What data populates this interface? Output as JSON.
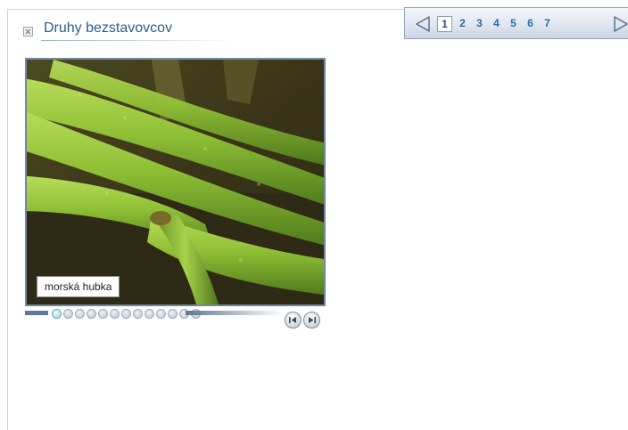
{
  "header": {
    "title": "Druhy bezstavovcov",
    "close_icon": "x-icon"
  },
  "pager": {
    "prev_icon": "triangle-left-icon",
    "next_icon": "triangle-right-icon",
    "pages": [
      "1",
      "2",
      "3",
      "4",
      "5",
      "6",
      "7"
    ],
    "current_page": "1"
  },
  "gallery": {
    "caption": "morská hubka",
    "slide_count": 13,
    "current_slide": 1,
    "prev_icon": "rewind-icon",
    "next_icon": "forward-icon"
  },
  "colors": {
    "title": "#2a5d8c",
    "page_link": "#2d6aa6",
    "frame_border": "#6f89a3",
    "active_dot": "#9fd9ea"
  }
}
